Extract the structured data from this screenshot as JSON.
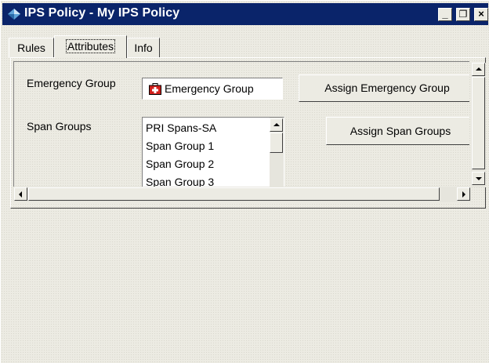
{
  "window": {
    "title": "IPS Policy - My IPS Policy",
    "icon": "policy-diamond-icon",
    "controls": {
      "minimize": "_",
      "restore": "❐",
      "close": "×"
    }
  },
  "tabs": [
    {
      "label": "Rules",
      "active": false
    },
    {
      "label": "Attributes",
      "active": true
    },
    {
      "label": "Info",
      "active": false
    }
  ],
  "attributes": {
    "emergency_label": "Emergency Group",
    "emergency_value": "Emergency Group",
    "emergency_icon": "first-aid-kit-icon",
    "assign_emergency_button": "Assign Emergency Group",
    "span_label": "Span Groups",
    "span_items": [
      "PRI Spans-SA",
      "Span Group 1",
      "Span Group 2",
      "Span Group 3"
    ],
    "assign_span_button": "Assign Span Groups"
  },
  "colors": {
    "titlebar": "#0a246a",
    "face": "#ecebe3",
    "icon_red": "#d2201c"
  }
}
